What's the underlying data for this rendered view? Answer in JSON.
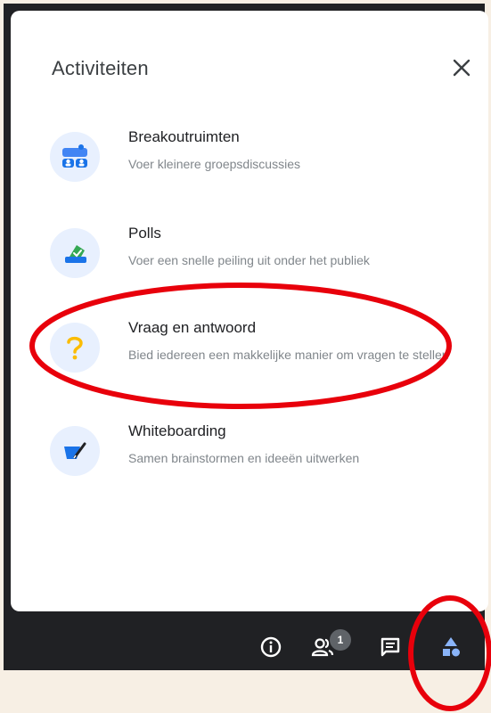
{
  "panel": {
    "title": "Activiteiten",
    "close_icon": "close-icon"
  },
  "activities": [
    {
      "title": "Breakoutruimten",
      "description": "Voer kleinere groepsdiscussies",
      "icon": "breakout-rooms-icon"
    },
    {
      "title": "Polls",
      "description": "Voer een snelle peiling uit onder het publiek",
      "icon": "poll-icon"
    },
    {
      "title": "Vraag en antwoord",
      "description": "Bied iedereen een makkelijke manier om vragen te stellen",
      "icon": "question-icon"
    },
    {
      "title": "Whiteboarding",
      "description": "Samen brainstormen en ideeën uitwerken",
      "icon": "whiteboard-icon"
    }
  ],
  "bottom_bar": {
    "info_icon": "info-icon",
    "people_icon": "people-icon",
    "people_count": "1",
    "chat_icon": "chat-icon",
    "activities_icon": "activities-icon"
  },
  "colors": {
    "page_background": "#f7efe4",
    "bar": "#202124",
    "accent_blue": "#8ab4f8",
    "highlight_red": "#e8000b"
  }
}
